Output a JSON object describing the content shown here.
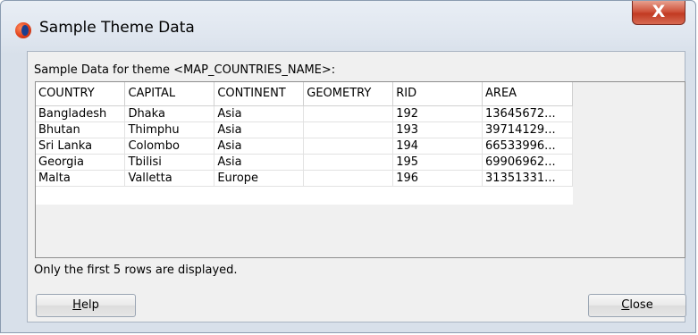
{
  "window": {
    "title": "Sample Theme Data",
    "close_glyph": "X",
    "icon": "oracle-app-icon"
  },
  "section_label": "Sample Data for theme <MAP_COUNTRIES_NAME>:",
  "table": {
    "columns": [
      "COUNTRY",
      "CAPITAL",
      "CONTINENT",
      "GEOMETRY",
      "RID",
      "AREA"
    ],
    "rows": [
      [
        "Bangladesh",
        "Dhaka",
        "Asia",
        "",
        "192",
        "13645672..."
      ],
      [
        "Bhutan",
        "Thimphu",
        "Asia",
        "",
        "193",
        "39714129..."
      ],
      [
        "Sri Lanka",
        "Colombo",
        "Asia",
        "",
        "194",
        "66533996..."
      ],
      [
        "Georgia",
        "Tbilisi",
        "Asia",
        "",
        "195",
        "69906962..."
      ],
      [
        "Malta",
        "Valletta",
        "Europe",
        "",
        "196",
        "31351331..."
      ]
    ]
  },
  "footnote": "Only the first 5 rows are displayed.",
  "buttons": {
    "help_mnemonic": "H",
    "help_rest": "elp",
    "close_mnemonic": "C",
    "close_rest": "lose"
  }
}
